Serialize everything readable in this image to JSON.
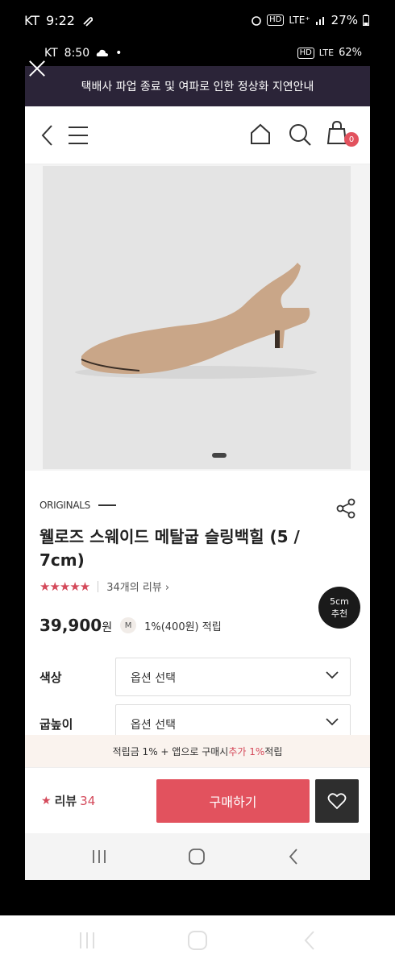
{
  "outer_status": {
    "carrier": "KT",
    "time": "9:22",
    "battery": "27%",
    "network": "LTE⁺",
    "hd": "HD"
  },
  "inner_status": {
    "carrier": "KT",
    "time": "8:50",
    "battery": "62%",
    "network": "LTE",
    "hd": "HD"
  },
  "notice": {
    "text": "택배사 파업 종료 및 여파로 인한 정상화 지연안내"
  },
  "header": {
    "cart_count": "0"
  },
  "product": {
    "brand": "ORIGINALS",
    "title": "웰로즈 스웨이드 메탈굽 슬링백힐 (5 / 7cm)",
    "stars": "★★★★★",
    "review_link": "34개의 리뷰",
    "recommend_line1": "5cm",
    "recommend_line2": "추천",
    "price": "39,900",
    "price_unit": "원",
    "member_badge": "M",
    "points": "1%(400원) 적립"
  },
  "options": [
    {
      "label": "색상",
      "value": "옵션 선택"
    },
    {
      "label": "굽높이",
      "value": "옵션 선택"
    }
  ],
  "promo": {
    "prefix": "적립금 1% + 앱으로 구매시 ",
    "highlight": "추가 1%",
    "suffix": "적립"
  },
  "bottom": {
    "review_label": "리뷰",
    "review_count": "34",
    "buy_label": "구매하기"
  },
  "colors": {
    "accent": "#e2525e",
    "notice_bg": "#2b2438",
    "star": "#d4495a"
  }
}
